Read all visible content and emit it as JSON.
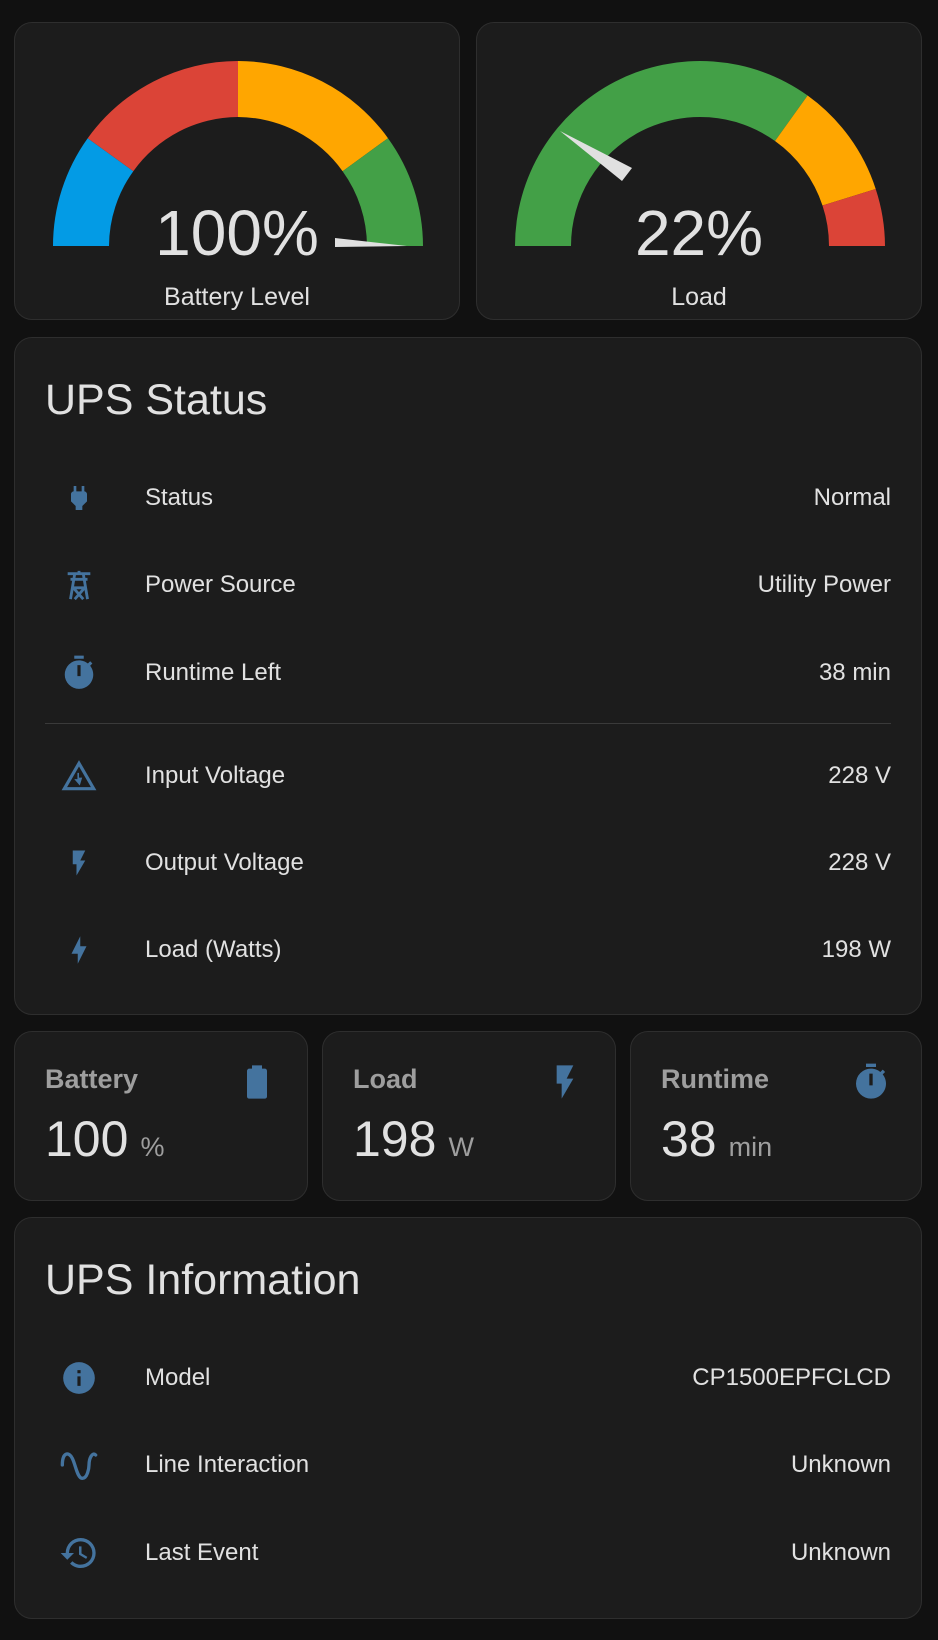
{
  "gauges": [
    {
      "value_text": "100%",
      "label": "Battery Level",
      "value": 100,
      "segments": [
        "#039be5",
        "#db4437",
        "#ffa600",
        "#43a047"
      ]
    },
    {
      "value_text": "22%",
      "label": "Load",
      "value": 22,
      "segments": [
        "#43a047",
        "#ffa600",
        "#db4437"
      ]
    }
  ],
  "ups_status": {
    "title": "UPS Status",
    "rows": [
      {
        "icon": "power-plug-icon",
        "label": "Status",
        "value": "Normal"
      },
      {
        "icon": "transmission-tower-icon",
        "label": "Power Source",
        "value": "Utility Power"
      },
      {
        "icon": "timer-icon",
        "label": "Runtime Left",
        "value": "38 min"
      },
      {
        "icon": "flash-triangle-icon",
        "label": "Input Voltage",
        "value": "228 V"
      },
      {
        "icon": "flash-icon",
        "label": "Output Voltage",
        "value": "228 V"
      },
      {
        "icon": "lightning-bolt-icon",
        "label": "Load (Watts)",
        "value": "198 W"
      }
    ]
  },
  "tiles": [
    {
      "name": "Battery",
      "value": "100",
      "unit": "%",
      "icon": "battery-icon"
    },
    {
      "name": "Load",
      "value": "198",
      "unit": "W",
      "icon": "flash-icon"
    },
    {
      "name": "Runtime",
      "value": "38",
      "unit": "min",
      "icon": "timer-icon"
    }
  ],
  "ups_info": {
    "title": "UPS Information",
    "rows": [
      {
        "icon": "information-icon",
        "label": "Model",
        "value": "CP1500EPFCLCD"
      },
      {
        "icon": "sine-wave-icon",
        "label": "Line Interaction",
        "value": "Unknown"
      },
      {
        "icon": "history-icon",
        "label": "Last Event",
        "value": "Unknown"
      }
    ]
  },
  "colors": {
    "card": "#1c1c1c",
    "icon": "#44739e",
    "green": "#43a047",
    "yellow": "#ffa600",
    "red": "#db4437",
    "blue": "#039be5"
  }
}
